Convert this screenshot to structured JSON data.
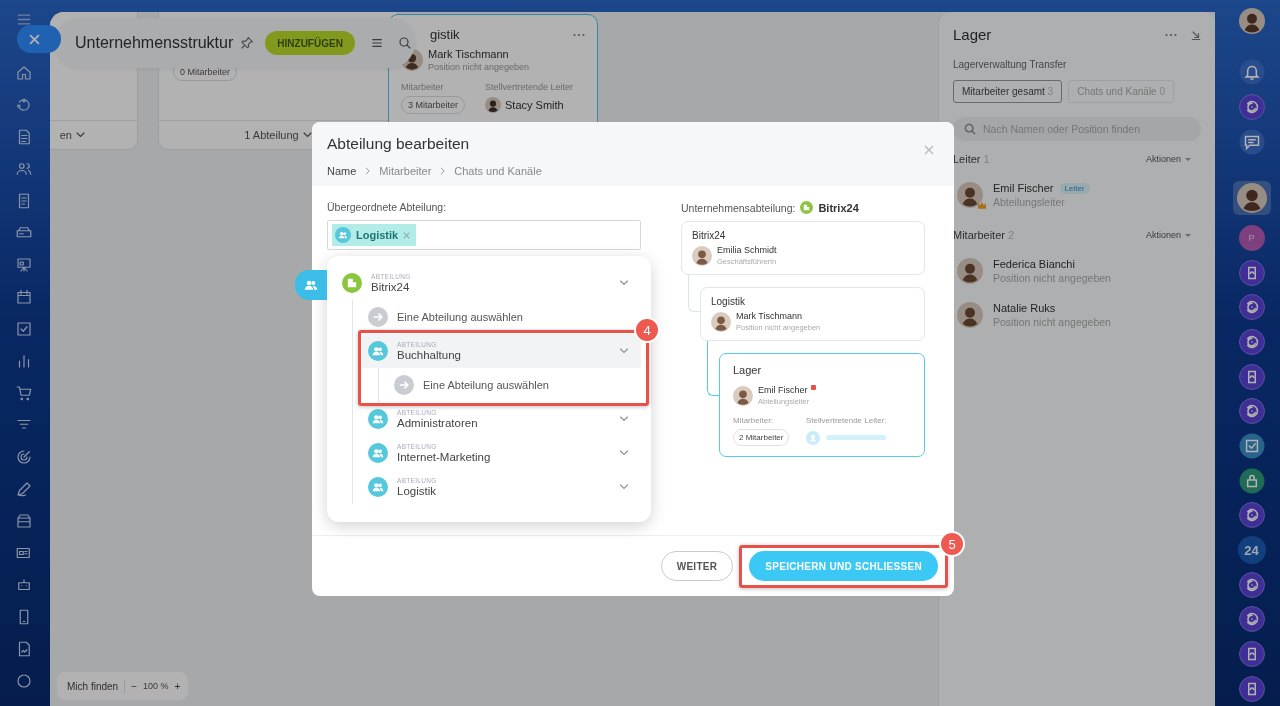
{
  "header": {
    "title": "Unternehmensstruktur",
    "add_button": "HINZUFÜGEN"
  },
  "canvas_cards": [
    {
      "kind": "stub",
      "selected": false,
      "footer": "en"
    },
    {
      "kind": "count",
      "selected": false,
      "badge": "0 Mitarbeiter",
      "footer": "1 Abteilung"
    },
    {
      "kind": "department",
      "selected": true,
      "title": "gistik",
      "manager": {
        "name": "Mark Tischmann",
        "position": "Position nicht angegeben"
      },
      "staff_label": "Mitarbeiter",
      "staff_badge": "3 Mitarbeiter",
      "deputy_label": "Stellvertretende Leiter",
      "deputy": "Stacy Smith"
    }
  ],
  "zoom_bar": {
    "find": "Mich finden",
    "minus": "−",
    "level": "100 %",
    "plus": "+"
  },
  "side_panel": {
    "title": "Lager",
    "subtitle": "Lagerverwaltung Transfer",
    "tabs": [
      {
        "label": "Mitarbeiter gesamt",
        "count": "3",
        "selected": true
      },
      {
        "label": "Chats und Kanäle",
        "count": "0",
        "selected": false
      }
    ],
    "search": {
      "placeholder": "Nach Namen oder Position finden"
    },
    "sections": [
      {
        "title": "Leiter",
        "count": "1",
        "action": "Aktionen",
        "people": [
          {
            "name": "Emil Fischer",
            "badge": "Leiter",
            "position": "Abteilungsleiter",
            "head": true
          }
        ]
      },
      {
        "title": "Mitarbeiter",
        "count": "2",
        "action": "Aktionen",
        "people": [
          {
            "name": "Federica Bianchi",
            "position": "Position nicht angegeben",
            "head": false
          },
          {
            "name": "Natalie Ruks",
            "position": "Position nicht angegeben",
            "head": false
          }
        ]
      }
    ]
  },
  "right_rail": [
    {
      "kind": "user",
      "selected": false
    },
    {
      "kind": "bell",
      "selected": false
    },
    {
      "kind": "cycle",
      "selected": false
    },
    {
      "kind": "chat",
      "selected": false
    },
    {
      "kind": "avatar",
      "selected": true
    },
    {
      "kind": "letter",
      "label": "P",
      "selected": false
    },
    {
      "kind": "book",
      "selected": false
    },
    {
      "kind": "cycle",
      "selected": false
    },
    {
      "kind": "cycle",
      "selected": false
    },
    {
      "kind": "book",
      "selected": false
    },
    {
      "kind": "cycle",
      "selected": false
    },
    {
      "kind": "task",
      "selected": false
    },
    {
      "kind": "lock",
      "selected": false
    },
    {
      "kind": "cycle",
      "selected": false
    },
    {
      "kind": "number",
      "label": "24",
      "selected": false
    },
    {
      "kind": "cycle",
      "selected": false
    },
    {
      "kind": "cycle",
      "selected": false
    },
    {
      "kind": "book",
      "selected": false
    },
    {
      "kind": "book",
      "selected": false
    }
  ],
  "modal": {
    "title": "Abteilung bearbeiten",
    "steps": [
      {
        "label": "Name",
        "selected": true
      },
      {
        "label": "Mitarbeiter",
        "selected": false
      },
      {
        "label": "Chats und Kanäle",
        "selected": false
      }
    ],
    "parent_label": "Übergeordnete Abteilung:",
    "parent_tag": "Logistik",
    "dropdown": {
      "items": [
        {
          "kind": "company",
          "caption": "ABTEILUNG",
          "name": "Bitrix24",
          "hovered": false,
          "children": [
            {
              "kind": "select",
              "label": "Eine Abteilung auswählen"
            },
            {
              "kind": "department",
              "caption": "ABTEILUNG",
              "name": "Buchhaltung",
              "hovered": true,
              "callout": "4",
              "children": [
                {
                  "kind": "select",
                  "label": "Eine Abteilung auswählen"
                }
              ]
            },
            {
              "kind": "department",
              "caption": "ABTEILUNG",
              "name": "Administratoren",
              "hovered": false
            },
            {
              "kind": "department",
              "caption": "ABTEILUNG",
              "name": "Internet-Marketing",
              "hovered": false
            },
            {
              "kind": "department",
              "caption": "ABTEILUNG",
              "name": "Logistik",
              "hovered": false
            }
          ]
        }
      ]
    },
    "preview": {
      "label": "Unternehmensabteilung:",
      "company": "Bitrix24",
      "nodes": [
        {
          "title": "Bitrix24",
          "selected": false,
          "person": {
            "name": "Emilia Schmidt",
            "position": "Geschäftsführerin",
            "notified": false
          },
          "children": [
            {
              "title": "Logistik",
              "selected": false,
              "person": {
                "name": "Mark Tischmann",
                "position": "Position nicht angegeben",
                "notified": false
              },
              "children": [
                {
                  "title": "Lager",
                  "selected": true,
                  "person": {
                    "name": "Emil Fischer",
                    "position": "Abteilungsleiter",
                    "notified": true
                  },
                  "staff_label": "Mitarbeiter:",
                  "staff_badge": "2 Mitarbeiter",
                  "deputy_label": "Stellvertretende Leiter:"
                }
              ]
            }
          ]
        }
      ]
    },
    "buttons": [
      {
        "kind": "secondary",
        "label": "WEITER"
      },
      {
        "kind": "primary",
        "label": "SPEICHERN UND SCHLIESSEN",
        "callout": "5"
      }
    ]
  }
}
